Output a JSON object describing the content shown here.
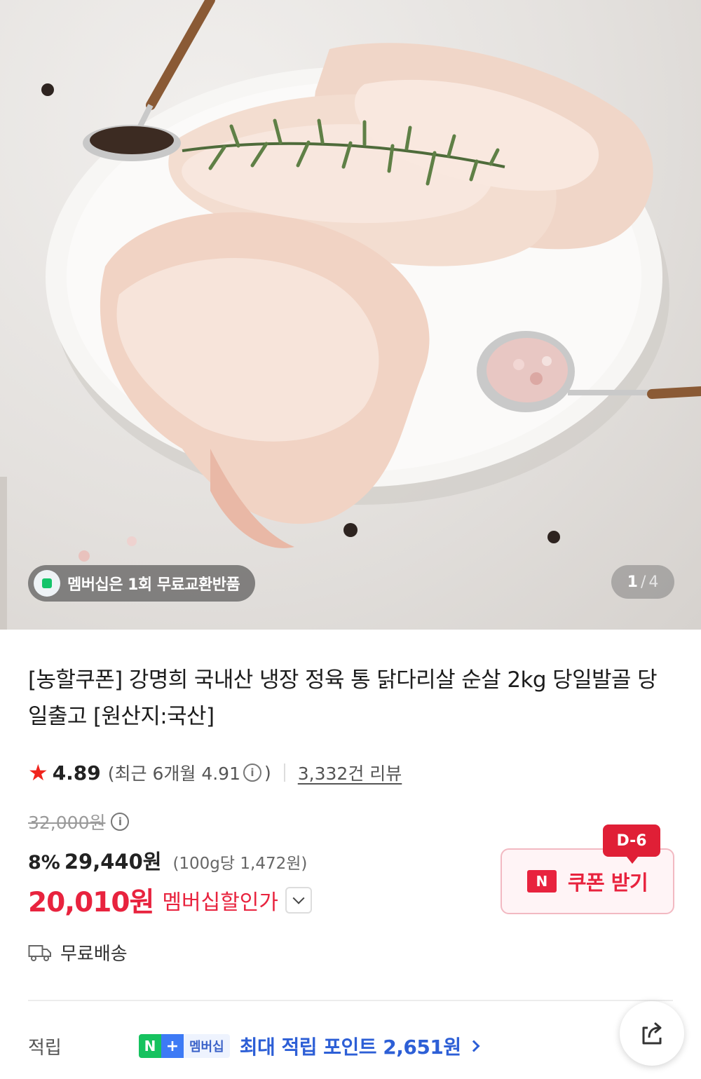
{
  "hero": {
    "membership_notice": "멤버십은 1회 무료교환반품",
    "image_counter": {
      "current": "1",
      "separator": "/",
      "total": "4"
    }
  },
  "product": {
    "title": "[농할쿠폰] 강명희 국내산 냉장 정육 통 닭다리살 순살 2kg 당일발골 당일출고 [원산지:국산]",
    "rating": "4.89",
    "recent_rating": "(최근 6개월 4.91",
    "recent_rating_close": ")",
    "info_icon_glyph": "i",
    "review_count": "3,332건 리뷰"
  },
  "price": {
    "original": "32,000원",
    "discount_rate": "8%",
    "sale_price": "29,440원",
    "unit_price": "(100g당 1,472원)",
    "member_price": "20,010원",
    "member_price_label": "멤버십할인가"
  },
  "coupon": {
    "dday": "D-6",
    "logo_text": "N",
    "label": "쿠폰 받기"
  },
  "shipping": {
    "label": "무료배송"
  },
  "points": {
    "label": "적립",
    "badge_n": "N",
    "badge_plus": "+",
    "badge_membership": "멤버십",
    "text": "최대 적립 포인트 2,651원"
  },
  "icons": {
    "star": "star-icon",
    "truck": "truck-icon",
    "share": "share-icon",
    "dropdown": "chevron-down-icon"
  },
  "colors": {
    "accent_red": "#e8233e",
    "star_red": "#f0241d",
    "naver_green": "#16c25f",
    "points_blue": "#2d5fd6"
  }
}
